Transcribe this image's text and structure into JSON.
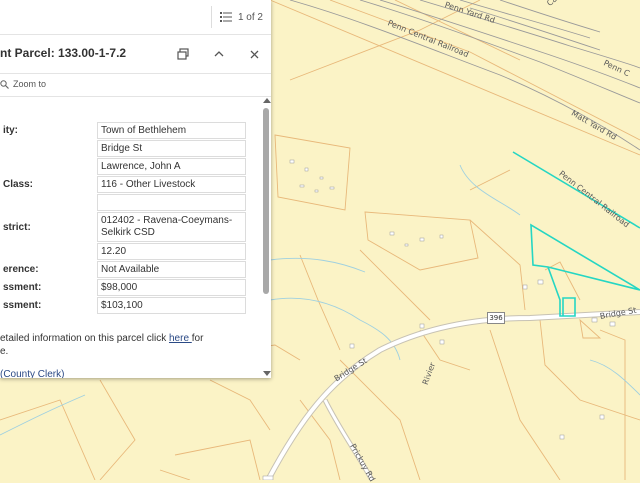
{
  "map": {
    "roads": {
      "penn_yard_rd": "Penn Yard Rd",
      "penn_central_railroad_1": "Penn Central Railroad",
      "penn_central_railroad_2": "Penn Central Railroad",
      "matt_yard_rd": "Matt Yard Rd",
      "penn_c": "Penn C",
      "bridge_st_1": "Bridge St",
      "bridge_st_2": "Bridge St",
      "route_shield": "396",
      "rivier": "Rivier",
      "prickuy_rd": "Prickuy Rd",
      "ca": "Ca"
    }
  },
  "popup": {
    "pager": "1 of 2",
    "title": "nt Parcel: 133.00-1-7.2",
    "zoom_to": "Zoom to",
    "rows": [
      {
        "label": "ity:",
        "value": "Town of Bethlehem"
      },
      {
        "label": "",
        "value": "Bridge St"
      },
      {
        "label": "",
        "value": "Lawrence, John A"
      },
      {
        "label": "Class:",
        "value": "116 - Other Livestock"
      },
      {
        "label": "",
        "value": ""
      },
      {
        "label": "strict:",
        "value": "012402 - Ravena-Coeymans-Selkirk CSD"
      },
      {
        "label": "",
        "value": "12.20"
      },
      {
        "label": "erence:",
        "value": "Not Available"
      },
      {
        "label": "ssment:",
        "value": "$98,000"
      },
      {
        "label": "ssment:",
        "value": "$103,100"
      }
    ],
    "footer_text": "etailed information on this parcel click ",
    "footer_link": "here ",
    "footer_after": "for",
    "footer_line2": "e.",
    "clerk_link": "(County Clerk)"
  }
}
